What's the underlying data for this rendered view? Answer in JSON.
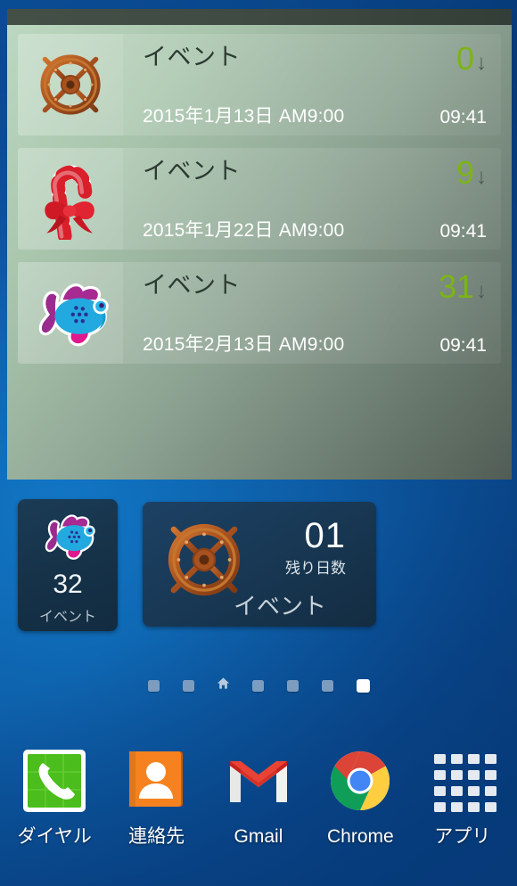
{
  "countdown_widget": {
    "header_bar_color": "#3f4b43",
    "panel_gradient_from": "#bcd8c0",
    "panel_gradient_to": "#515d54",
    "accent_green": "#7cb319",
    "events": [
      {
        "icon": "ship-wheel-icon",
        "title": "イベント",
        "date": "2015年1月13日 AM9:00",
        "count": "0",
        "arrow": "↓",
        "time": "09:41"
      },
      {
        "icon": "candy-cane-icon",
        "title": "イベント",
        "date": "2015年1月22日 AM9:00",
        "count": "9",
        "arrow": "↓",
        "time": "09:41"
      },
      {
        "icon": "fish-icon",
        "title": "イベント",
        "date": "2015年2月13日 AM9:00",
        "count": "31",
        "arrow": "↓",
        "time": "09:41"
      }
    ]
  },
  "fish_widget": {
    "icon": "fish-icon",
    "count": "32",
    "label": "イベント",
    "background_color": "#16334a"
  },
  "wheel_widget": {
    "icon": "ship-wheel-icon",
    "count": "01",
    "sublabel": "残り日数",
    "title": "イベント",
    "background_color": "#193a57"
  },
  "page_indicator": {
    "dots": [
      {
        "name": "page-dot-1",
        "type": "dot",
        "active": false
      },
      {
        "name": "page-dot-2",
        "type": "dot",
        "active": false
      },
      {
        "name": "page-dot-home",
        "type": "home",
        "active": false
      },
      {
        "name": "page-dot-4",
        "type": "dot",
        "active": false
      },
      {
        "name": "page-dot-5",
        "type": "dot",
        "active": false
      },
      {
        "name": "page-dot-6",
        "type": "dot",
        "active": false
      },
      {
        "name": "page-dot-7",
        "type": "dot",
        "active": true
      }
    ],
    "current_page": 7,
    "total_pages": 7
  },
  "dock": {
    "items": [
      {
        "icon": "phone-dialer-icon",
        "label": "ダイヤル"
      },
      {
        "icon": "contacts-icon",
        "label": "連絡先"
      },
      {
        "icon": "gmail-icon",
        "label": "Gmail"
      },
      {
        "icon": "chrome-icon",
        "label": "Chrome"
      },
      {
        "icon": "apps-grid-icon",
        "label": "アプリ"
      }
    ]
  },
  "wallpaper": {
    "color_light": "#1277c6",
    "color_dark": "#063671"
  }
}
